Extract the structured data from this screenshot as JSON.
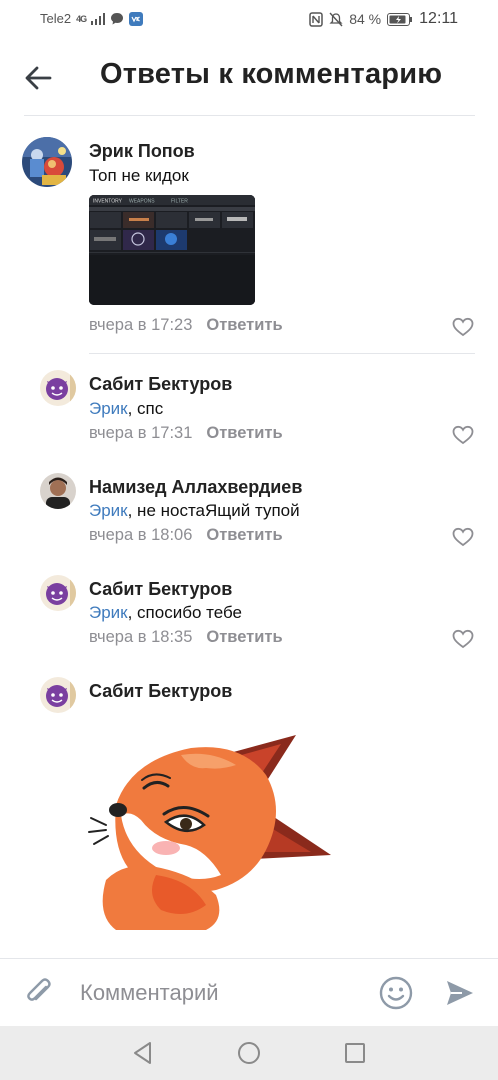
{
  "status_bar": {
    "carrier": "Tele2",
    "network": "4G",
    "battery_percent": "84 %",
    "time": "12:11"
  },
  "header": {
    "title": "Ответы к комментарию"
  },
  "comments": [
    {
      "author": "Эрик Попов",
      "text": "Топ не кидок",
      "time": "вчера в 17:23",
      "reply_label": "Ответить",
      "has_attachment": true,
      "attachment_labels": [
        "INVENTORY",
        "WEAPONS",
        "FILTER"
      ]
    },
    {
      "author": "Сабит Бектуров",
      "mention": "Эрик",
      "text": ", спс",
      "time": "вчера в 17:31",
      "reply_label": "Ответить"
    },
    {
      "author": "Намизед Аллахвердиев",
      "mention": "Эрик",
      "text": ", не ностаЯщий тупой",
      "time": "вчера в 18:06",
      "reply_label": "Ответить"
    },
    {
      "author": "Сабит Бектуров",
      "mention": "Эрик",
      "text": ", спосибо тебе",
      "time": "вчера в 18:35",
      "reply_label": "Ответить"
    },
    {
      "author": "Сабит Бектуров",
      "sticker": "fox-sticker"
    }
  ],
  "composer": {
    "placeholder": "Комментарий"
  },
  "colors": {
    "mention": "#3f7bbd",
    "meta": "#8e8e93",
    "title": "#222222",
    "send": "#8e9aa8"
  }
}
